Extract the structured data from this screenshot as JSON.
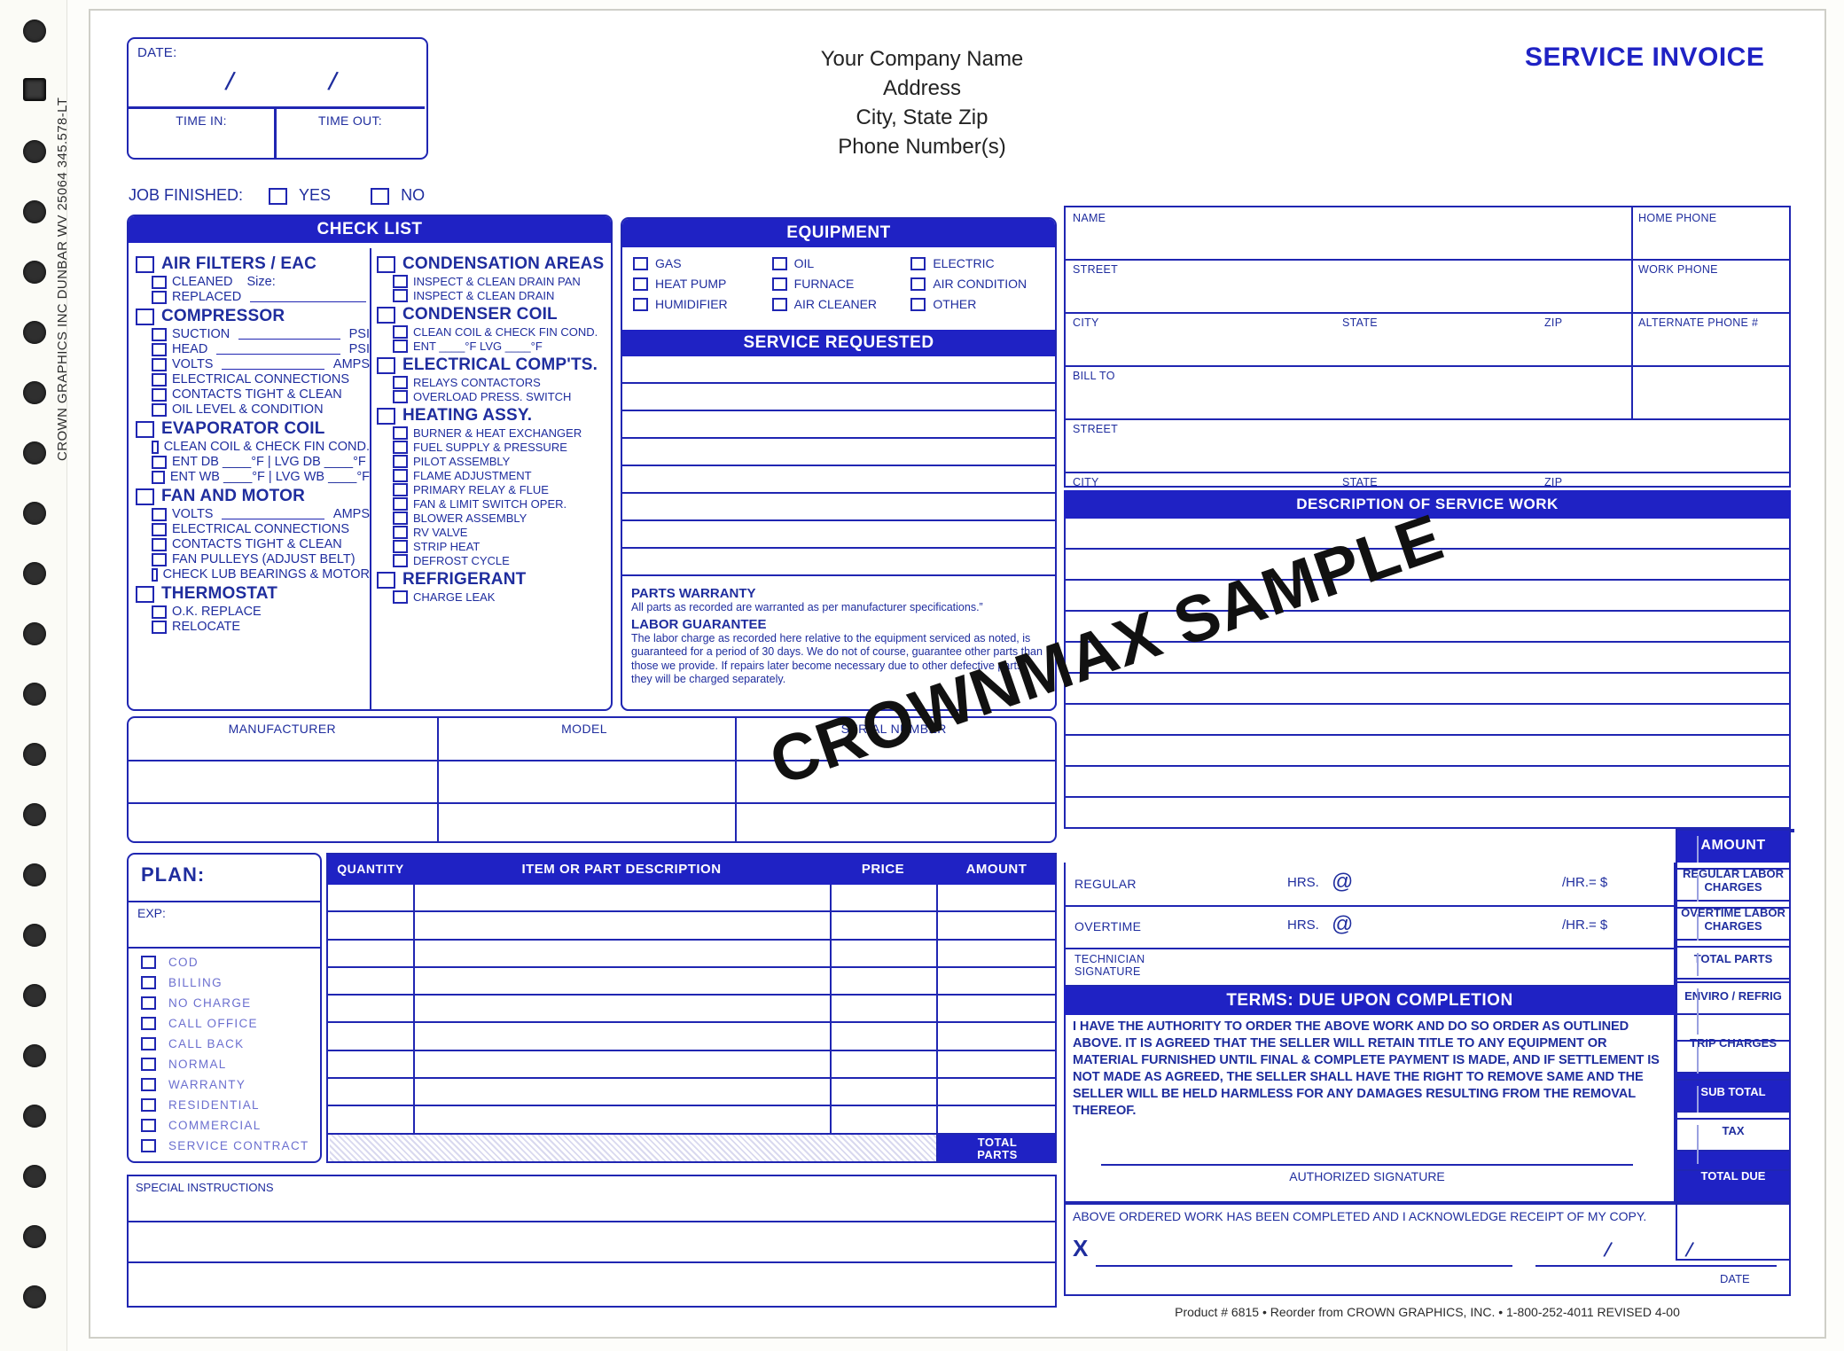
{
  "document": {
    "title": "SERVICE INVOICE",
    "watermark": "CROWNMAX SAMPLE",
    "side_imprint": "CROWN GRAPHICS INC  DUNBAR WV 25064  345.578-LT",
    "footer": "Product # 6815 • Reorder from CROWN GRAPHICS, INC. • 1-800-252-4011    REVISED 4-00"
  },
  "company": {
    "name": "Your Company Name",
    "address": "Address",
    "city_state_zip": "City, State Zip",
    "phone": "Phone Number(s)"
  },
  "datebox": {
    "label": "DATE:",
    "slash1": "/",
    "slash2": "/",
    "time_in": "TIME IN:",
    "time_out": "TIME OUT:"
  },
  "job_finished": {
    "label": "JOB FINISHED:",
    "yes": "YES",
    "no": "NO"
  },
  "checklist": {
    "header": "CHECK LIST",
    "left": [
      {
        "title": "AIR FILTERS / EAC",
        "items": [
          {
            "text": "CLEANED",
            "extra": "Size:"
          },
          {
            "text": "REPLACED",
            "rule": true
          }
        ]
      },
      {
        "title": "COMPRESSOR",
        "items": [
          {
            "text": "SUCTION",
            "rule": true,
            "unit": "PSI"
          },
          {
            "text": "HEAD",
            "rule": true,
            "unit": "PSI"
          },
          {
            "text": "VOLTS",
            "rule": true,
            "unit": "AMPS"
          },
          {
            "text": "ELECTRICAL CONNECTIONS"
          },
          {
            "text": "CONTACTS TIGHT & CLEAN"
          },
          {
            "text": "OIL LEVEL & CONDITION"
          }
        ]
      },
      {
        "title": "EVAPORATOR COIL",
        "items": [
          {
            "text": "CLEAN COIL & CHECK FIN COND."
          },
          {
            "text": "ENT DB ____°F  |  LVG DB ____°F"
          },
          {
            "text": "ENT WB ____°F  |  LVG WB ____°F"
          }
        ]
      },
      {
        "title": "FAN AND MOTOR",
        "items": [
          {
            "text": "VOLTS",
            "rule": true,
            "unit": "AMPS"
          },
          {
            "text": "ELECTRICAL CONNECTIONS"
          },
          {
            "text": "CONTACTS TIGHT & CLEAN"
          },
          {
            "text": "FAN PULLEYS (ADJUST BELT)"
          },
          {
            "text": "CHECK LUB BEARINGS & MOTOR"
          }
        ]
      },
      {
        "title": "THERMOSTAT",
        "items": [
          {
            "text": "O.K.        REPLACE",
            "double": true
          },
          {
            "text": "RELOCATE"
          }
        ]
      }
    ],
    "right": [
      {
        "title": "CONDENSATION AREAS",
        "items": [
          {
            "text": "INSPECT & CLEAN DRAIN PAN"
          },
          {
            "text": "INSPECT & CLEAN DRAIN"
          }
        ]
      },
      {
        "title": "CONDENSER COIL",
        "items": [
          {
            "text": "CLEAN COIL & CHECK FIN COND."
          },
          {
            "text": "ENT ____°F   LVG ____°F"
          }
        ]
      },
      {
        "title": "ELECTRICAL COMP'TS.",
        "items": [
          {
            "text": "RELAYS        CONTACTORS",
            "double": true
          },
          {
            "text": "OVERLOAD    PRESS. SWITCH",
            "double": true
          }
        ]
      },
      {
        "title": "HEATING ASSY.",
        "items": [
          {
            "text": "BURNER & HEAT EXCHANGER"
          },
          {
            "text": "FUEL SUPPLY & PRESSURE"
          },
          {
            "text": "PILOT ASSEMBLY"
          },
          {
            "text": "FLAME ADJUSTMENT"
          },
          {
            "text": "PRIMARY RELAY & FLUE"
          },
          {
            "text": "FAN & LIMIT SWITCH OPER."
          },
          {
            "text": "BLOWER ASSEMBLY"
          },
          {
            "text": "RV VALVE"
          },
          {
            "text": "STRIP HEAT"
          },
          {
            "text": "DEFROST CYCLE"
          }
        ]
      },
      {
        "title": "REFRIGERANT",
        "items": [
          {
            "text": "CHARGE      LEAK",
            "double": true
          }
        ]
      }
    ]
  },
  "equipment": {
    "header": "EQUIPMENT",
    "items": [
      "GAS",
      "OIL",
      "ELECTRIC",
      "HEAT PUMP",
      "FURNACE",
      "AIR CONDITION",
      "HUMIDIFIER",
      "AIR CLEANER",
      "OTHER"
    ]
  },
  "service_requested": {
    "header": "SERVICE REQUESTED"
  },
  "warranty": {
    "parts_title": "PARTS WARRANTY",
    "parts_text": "All parts as recorded are warranted as per manufacturer specifications.”",
    "labor_title": "LABOR GUARANTEE",
    "labor_text": "The labor charge as recorded here relative to the equipment serviced as noted, is guaranteed for a period of 30 days.  We do not of course, guarantee other parts than those we provide.  If repairs later become necessary due to other defective parts, they will be charged separately."
  },
  "equip_table": {
    "headers": [
      "MANUFACTURER",
      "MODEL",
      "SERIAL NUMBER"
    ]
  },
  "customer": {
    "name": "NAME",
    "home_phone": "HOME PHONE",
    "street": "STREET",
    "work_phone": "WORK PHONE",
    "city": "CITY",
    "state": "STATE",
    "zip": "ZIP",
    "alternate_phone": "ALTERNATE PHONE #",
    "bill_to": "BILL TO",
    "bill_street": "STREET",
    "bill_city": "CITY",
    "bill_state": "STATE",
    "bill_zip": "ZIP"
  },
  "description": {
    "header": "DESCRIPTION OF SERVICE WORK"
  },
  "plan": {
    "title": "PLAN:",
    "exp": "EXP:",
    "options": [
      "COD",
      "BILLING",
      "NO CHARGE",
      "CALL OFFICE",
      "CALL BACK",
      "NORMAL",
      "WARRANTY",
      "RESIDENTIAL",
      "COMMERCIAL",
      "SERVICE  CONTRACT"
    ]
  },
  "parts_table": {
    "headers": [
      "QUANTITY",
      "ITEM OR PART DESCRIPTION",
      "PRICE",
      "AMOUNT"
    ],
    "total_label": "TOTAL\nPARTS"
  },
  "labor": {
    "amount_header": "AMOUNT",
    "regular": "REGULAR",
    "overtime": "OVERTIME",
    "hrs": "HRS.",
    "at": "@",
    "per_hr": "/HR.= $",
    "technician_signature": "TECHNICIAN\nSIGNATURE",
    "rows": [
      "REGULAR LABOR CHARGES",
      "OVERTIME LABOR CHARGES",
      "TOTAL PARTS",
      "ENVIRO / REFRIG",
      "TRIP CHARGES",
      "SUB TOTAL",
      "TAX",
      "TOTAL DUE"
    ]
  },
  "terms": {
    "header": "TERMS: DUE UPON COMPLETION",
    "body": "I HAVE THE AUTHORITY TO ORDER THE ABOVE WORK AND DO SO ORDER AS OUTLINED ABOVE.  IT IS AGREED THAT THE SELLER WILL RETAIN TITLE TO ANY EQUIPMENT OR MATERIAL FURNISHED UNTIL FINAL & COMPLETE PAYMENT IS MADE, AND IF SETTLEMENT IS NOT MADE AS AGREED, THE SELLER SHALL HAVE THE RIGHT TO REMOVE SAME AND THE SELLER WILL BE HELD HARMLESS FOR ANY DAMAGES RESULTING FROM THE REMOVAL THEREOF.",
    "authorized_signature": "AUTHORIZED SIGNATURE"
  },
  "acknowledge": {
    "text": "ABOVE ORDERED WORK HAS BEEN COMPLETED AND I ACKNOWLEDGE RECEIPT OF MY COPY.",
    "x": "X",
    "slash1": "/",
    "slash2": "/",
    "date_label": "DATE"
  },
  "special_instructions": {
    "label": "SPECIAL INSTRUCTIONS"
  },
  "colors": {
    "brand_blue": "#1f22c4",
    "ink_blue": "#2026b2",
    "paper": "#fdfdfa"
  }
}
